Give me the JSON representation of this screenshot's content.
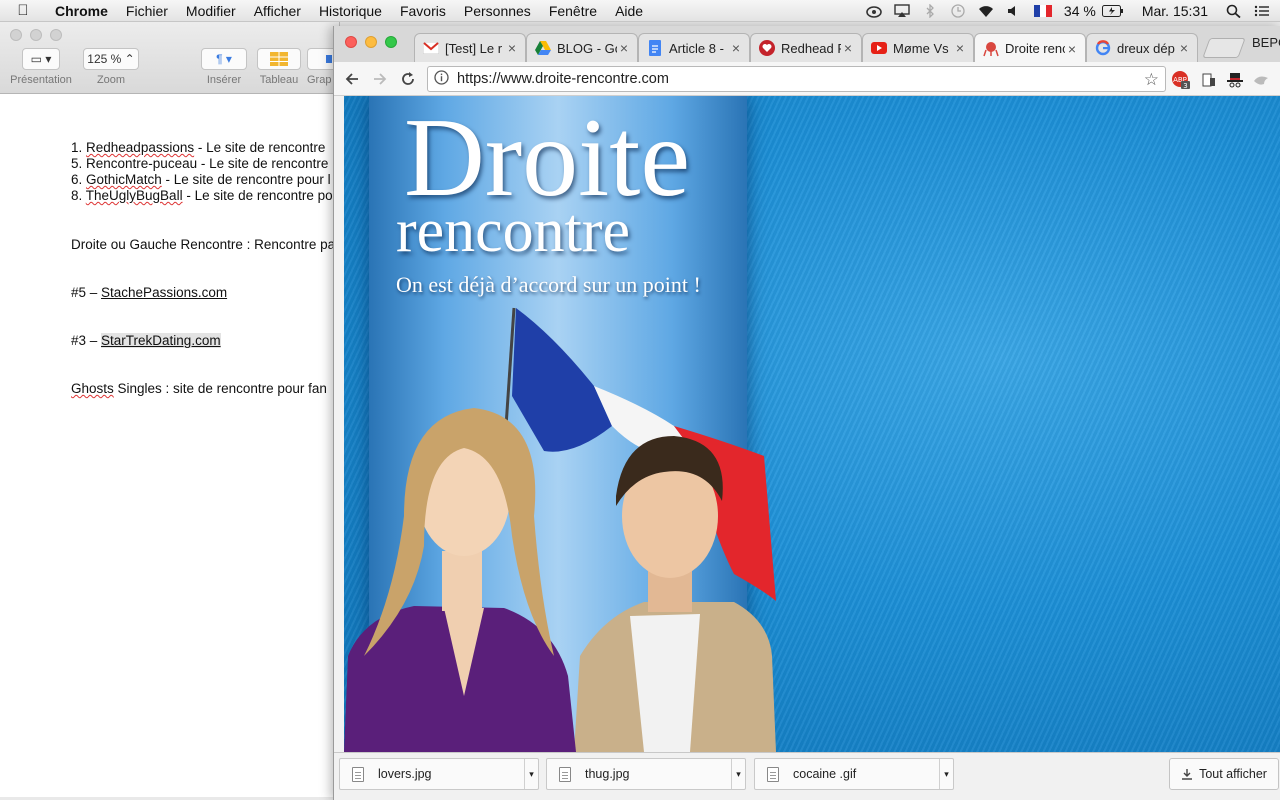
{
  "menubar": {
    "app": "Chrome",
    "items": [
      "Fichier",
      "Modifier",
      "Afficher",
      "Historique",
      "Favoris",
      "Personnes",
      "Fenêtre",
      "Aide"
    ],
    "battery": "34 %",
    "clock": "Mar. 15:31"
  },
  "pages": {
    "toolbar": {
      "presentation_label": "Présentation",
      "zoom_value": "125 %",
      "zoom_label": "Zoom",
      "insert_label": "Insérer",
      "table_label": "Tableau",
      "graph_label": "Grap"
    },
    "doc": {
      "list": [
        {
          "num": "1. ",
          "link": "Redheadpassions",
          "rest": " - Le site de rencontre"
        },
        {
          "num": "5. ",
          "link": "",
          "rest": "Rencontre-puceau - Le site de rencontre"
        },
        {
          "num": "6. ",
          "link": "GothicMatch",
          "rest": " - Le site de rencontre pour l"
        },
        {
          "num": "8. ",
          "link": "TheUglyBugBall",
          "rest": " - Le site de rencontre po"
        }
      ],
      "para1": "Droite ou Gauche Rencontre : Rencontre pa",
      "item5_prefix": "#5 – ",
      "item5_link": "StachePassions.com",
      "item3_prefix": "#3 – ",
      "item3_link": "StarTrekDating.com",
      "ghosts_word": "Ghosts",
      "ghosts_rest": " Singles  : site de rencontre pour fan"
    }
  },
  "chrome": {
    "tabs": [
      {
        "title": "[Test] Le r",
        "icon": "gmail-icon"
      },
      {
        "title": "BLOG - Go",
        "icon": "drive-icon"
      },
      {
        "title": "Article 8 -",
        "icon": "docs-icon"
      },
      {
        "title": "Redhead P",
        "icon": "heart-icon"
      },
      {
        "title": "Møme Vs I",
        "icon": "youtube-icon"
      },
      {
        "title": "Droite renc",
        "icon": "site-icon"
      },
      {
        "title": "dreux dép",
        "icon": "google-icon"
      }
    ],
    "profile": "BEPC",
    "url": "https://www.droite-rencontre.com",
    "extension_badge": "3"
  },
  "site": {
    "brand_line1": "Droite",
    "brand_line2": "rencontre",
    "tagline": "On est déjà d’accord sur un point !"
  },
  "downloads": {
    "files": [
      "lovers.jpg",
      "thug.jpg",
      "cocaine .gif"
    ],
    "show_all": "Tout afficher"
  },
  "colors": {
    "site_blue": "#1c8fd6",
    "flag_blue": "#1f3fa8",
    "flag_red": "#e3262c",
    "close": "#fc605c",
    "minimize": "#fdbc40",
    "zoom": "#34c84a"
  }
}
